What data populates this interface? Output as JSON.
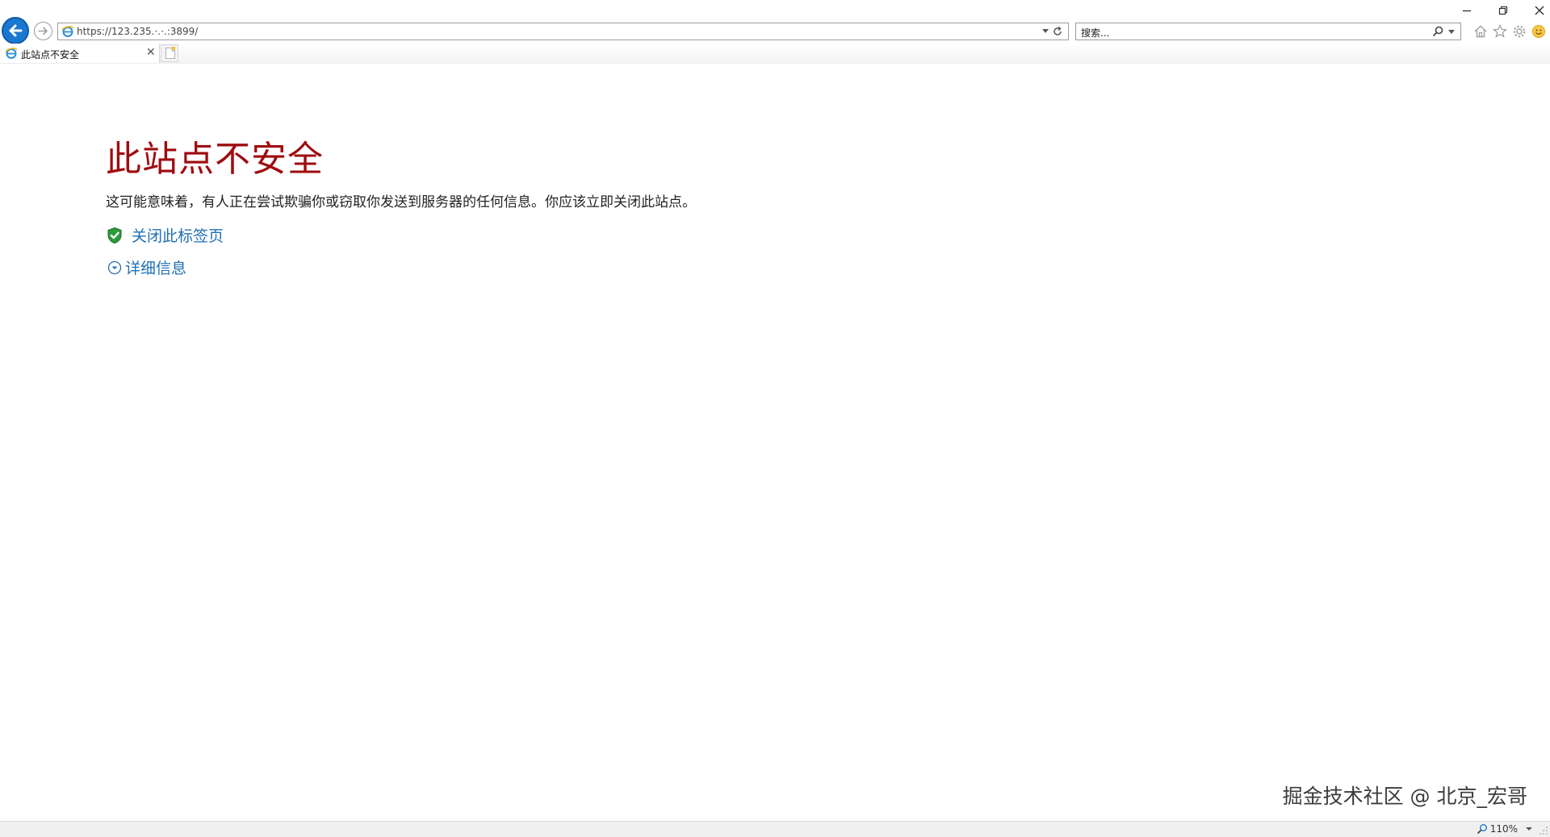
{
  "browser": {
    "address_url": "https://123.235.·.·.:3899/",
    "search_placeholder": "搜索...",
    "tab_title": "此站点不安全",
    "zoom_level": "110%"
  },
  "page": {
    "heading": "此站点不安全",
    "description": "这可能意味着，有人正在尝试欺骗你或窃取你发送到服务器的任何信息。你应该立即关闭此站点。",
    "close_tab_link": "关闭此标签页",
    "details_link": "详细信息"
  },
  "watermark": "掘金技术社区 @ 北京_宏哥",
  "colors": {
    "heading": "#9e0b0f",
    "link": "#1f6fb5",
    "back_button": "#1b78d0"
  }
}
